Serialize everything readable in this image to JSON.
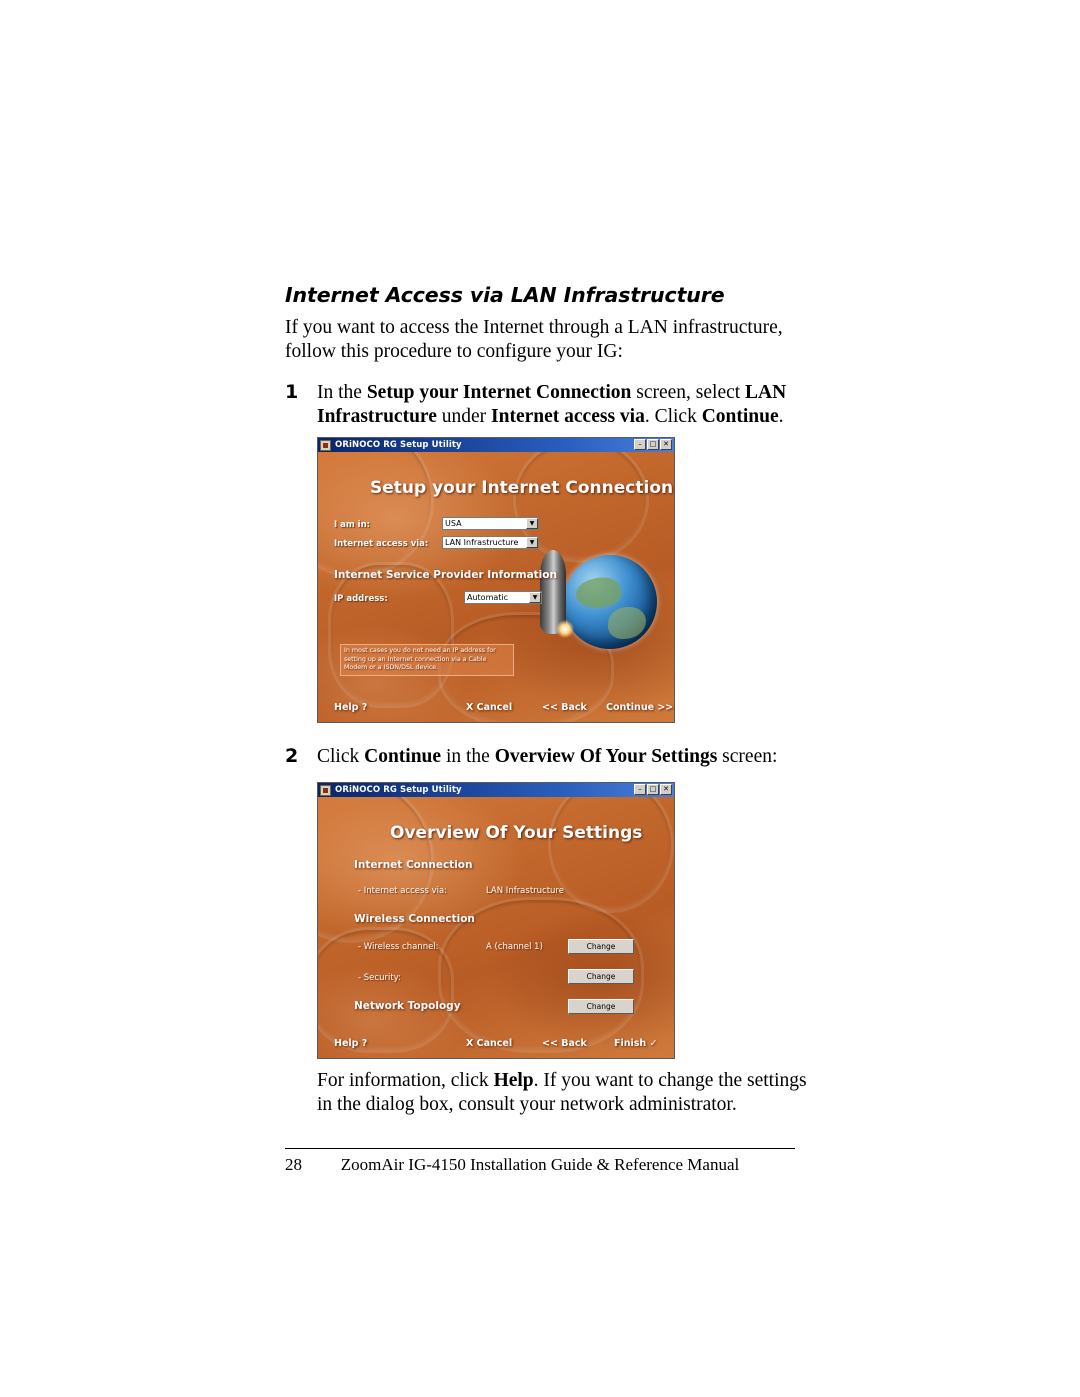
{
  "document": {
    "heading": "Internet Access via LAN Infrastructure",
    "intro": "If you want to access the Internet through a LAN infrastructure, follow this procedure to configure your IG:",
    "steps": [
      {
        "number": "1",
        "parts": [
          {
            "text": "In the ",
            "bold": false
          },
          {
            "text": "Setup your Internet Connection",
            "bold": true
          },
          {
            "text": " screen, select ",
            "bold": false
          },
          {
            "text": "LAN Infrastructure",
            "bold": true
          },
          {
            "text": " under ",
            "bold": false
          },
          {
            "text": "Internet access via",
            "bold": true
          },
          {
            "text": ". Click ",
            "bold": false
          },
          {
            "text": "Continue",
            "bold": true
          },
          {
            "text": ".",
            "bold": false
          }
        ]
      },
      {
        "number": "2",
        "parts": [
          {
            "text": "Click ",
            "bold": false
          },
          {
            "text": "Continue",
            "bold": true
          },
          {
            "text": " in the ",
            "bold": false
          },
          {
            "text": "Overview Of Your Settings",
            "bold": true
          },
          {
            "text": " screen:",
            "bold": false
          }
        ]
      }
    ],
    "closing": "For information, click Help. If you want to change the settings in the dialog box, consult your network administrator.",
    "closing_bold_word": "Help",
    "footer": {
      "page_number": "28",
      "title": "ZoomAir IG-4150 Installation Guide & Reference Manual"
    }
  },
  "screenshot1": {
    "titlebar": {
      "title": "ORiNOCO RG Setup Utility",
      "icon": "app-icon",
      "buttons": [
        "–",
        "□",
        "✕"
      ]
    },
    "window_title": "Setup your Internet Connection",
    "fields": [
      {
        "label": "I am in:",
        "value": "USA"
      },
      {
        "label": "Internet access via:",
        "value": "LAN Infrastructure"
      }
    ],
    "section_title": "Internet Service Provider Information",
    "isp_field": {
      "label": "IP address:",
      "value": "Automatic"
    },
    "tip": "In most cases you do not need an IP address for setting up an Internet connection via a Cable Modem or a ISDN/DSL device.",
    "buttons": {
      "help": "Help ?",
      "cancel": "X Cancel",
      "back": "<< Back",
      "continue": "Continue >>"
    }
  },
  "screenshot2": {
    "titlebar": {
      "title": "ORiNOCO RG Setup Utility",
      "icon": "app-icon",
      "buttons": [
        "–",
        "□",
        "✕"
      ]
    },
    "window_title": "Overview Of Your Settings",
    "sections": [
      {
        "title": "Internet Connection",
        "rows": [
          {
            "label": "- Internet access via:",
            "value": "LAN Infrastructure",
            "button": ""
          }
        ]
      },
      {
        "title": "Wireless Connection",
        "rows": [
          {
            "label": "- Wireless channel:",
            "value": "A (channel 1)",
            "button": "Change"
          },
          {
            "label": "- Security:",
            "value": "",
            "button": "Change"
          }
        ]
      },
      {
        "title": "Network Topology",
        "rows": [
          {
            "label": "",
            "value": "",
            "button": "Change"
          }
        ]
      }
    ],
    "buttons": {
      "help": "Help ?",
      "cancel": "X Cancel",
      "back": "<< Back",
      "finish": "Finish ✓"
    }
  }
}
